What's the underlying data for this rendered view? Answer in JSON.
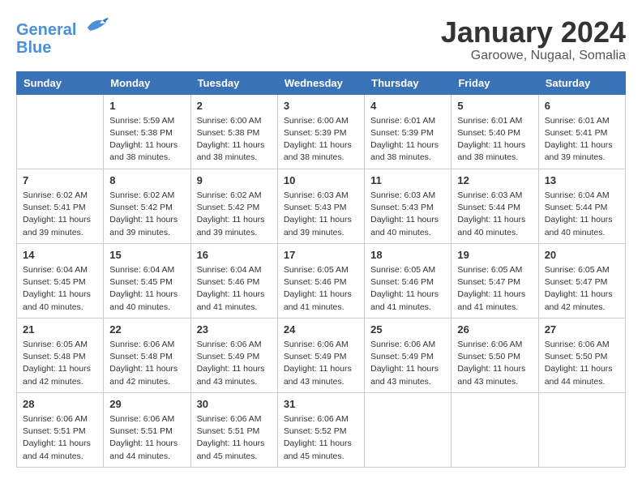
{
  "header": {
    "logo_line1": "General",
    "logo_line2": "Blue",
    "month_title": "January 2024",
    "subtitle": "Garoowe, Nugaal, Somalia"
  },
  "weekdays": [
    "Sunday",
    "Monday",
    "Tuesday",
    "Wednesday",
    "Thursday",
    "Friday",
    "Saturday"
  ],
  "weeks": [
    [
      {
        "day": "",
        "info": ""
      },
      {
        "day": "1",
        "info": "Sunrise: 5:59 AM\nSunset: 5:38 PM\nDaylight: 11 hours\nand 38 minutes."
      },
      {
        "day": "2",
        "info": "Sunrise: 6:00 AM\nSunset: 5:38 PM\nDaylight: 11 hours\nand 38 minutes."
      },
      {
        "day": "3",
        "info": "Sunrise: 6:00 AM\nSunset: 5:39 PM\nDaylight: 11 hours\nand 38 minutes."
      },
      {
        "day": "4",
        "info": "Sunrise: 6:01 AM\nSunset: 5:39 PM\nDaylight: 11 hours\nand 38 minutes."
      },
      {
        "day": "5",
        "info": "Sunrise: 6:01 AM\nSunset: 5:40 PM\nDaylight: 11 hours\nand 38 minutes."
      },
      {
        "day": "6",
        "info": "Sunrise: 6:01 AM\nSunset: 5:41 PM\nDaylight: 11 hours\nand 39 minutes."
      }
    ],
    [
      {
        "day": "7",
        "info": "Sunrise: 6:02 AM\nSunset: 5:41 PM\nDaylight: 11 hours\nand 39 minutes."
      },
      {
        "day": "8",
        "info": "Sunrise: 6:02 AM\nSunset: 5:42 PM\nDaylight: 11 hours\nand 39 minutes."
      },
      {
        "day": "9",
        "info": "Sunrise: 6:02 AM\nSunset: 5:42 PM\nDaylight: 11 hours\nand 39 minutes."
      },
      {
        "day": "10",
        "info": "Sunrise: 6:03 AM\nSunset: 5:43 PM\nDaylight: 11 hours\nand 39 minutes."
      },
      {
        "day": "11",
        "info": "Sunrise: 6:03 AM\nSunset: 5:43 PM\nDaylight: 11 hours\nand 40 minutes."
      },
      {
        "day": "12",
        "info": "Sunrise: 6:03 AM\nSunset: 5:44 PM\nDaylight: 11 hours\nand 40 minutes."
      },
      {
        "day": "13",
        "info": "Sunrise: 6:04 AM\nSunset: 5:44 PM\nDaylight: 11 hours\nand 40 minutes."
      }
    ],
    [
      {
        "day": "14",
        "info": "Sunrise: 6:04 AM\nSunset: 5:45 PM\nDaylight: 11 hours\nand 40 minutes."
      },
      {
        "day": "15",
        "info": "Sunrise: 6:04 AM\nSunset: 5:45 PM\nDaylight: 11 hours\nand 40 minutes."
      },
      {
        "day": "16",
        "info": "Sunrise: 6:04 AM\nSunset: 5:46 PM\nDaylight: 11 hours\nand 41 minutes."
      },
      {
        "day": "17",
        "info": "Sunrise: 6:05 AM\nSunset: 5:46 PM\nDaylight: 11 hours\nand 41 minutes."
      },
      {
        "day": "18",
        "info": "Sunrise: 6:05 AM\nSunset: 5:46 PM\nDaylight: 11 hours\nand 41 minutes."
      },
      {
        "day": "19",
        "info": "Sunrise: 6:05 AM\nSunset: 5:47 PM\nDaylight: 11 hours\nand 41 minutes."
      },
      {
        "day": "20",
        "info": "Sunrise: 6:05 AM\nSunset: 5:47 PM\nDaylight: 11 hours\nand 42 minutes."
      }
    ],
    [
      {
        "day": "21",
        "info": "Sunrise: 6:05 AM\nSunset: 5:48 PM\nDaylight: 11 hours\nand 42 minutes."
      },
      {
        "day": "22",
        "info": "Sunrise: 6:06 AM\nSunset: 5:48 PM\nDaylight: 11 hours\nand 42 minutes."
      },
      {
        "day": "23",
        "info": "Sunrise: 6:06 AM\nSunset: 5:49 PM\nDaylight: 11 hours\nand 43 minutes."
      },
      {
        "day": "24",
        "info": "Sunrise: 6:06 AM\nSunset: 5:49 PM\nDaylight: 11 hours\nand 43 minutes."
      },
      {
        "day": "25",
        "info": "Sunrise: 6:06 AM\nSunset: 5:49 PM\nDaylight: 11 hours\nand 43 minutes."
      },
      {
        "day": "26",
        "info": "Sunrise: 6:06 AM\nSunset: 5:50 PM\nDaylight: 11 hours\nand 43 minutes."
      },
      {
        "day": "27",
        "info": "Sunrise: 6:06 AM\nSunset: 5:50 PM\nDaylight: 11 hours\nand 44 minutes."
      }
    ],
    [
      {
        "day": "28",
        "info": "Sunrise: 6:06 AM\nSunset: 5:51 PM\nDaylight: 11 hours\nand 44 minutes."
      },
      {
        "day": "29",
        "info": "Sunrise: 6:06 AM\nSunset: 5:51 PM\nDaylight: 11 hours\nand 44 minutes."
      },
      {
        "day": "30",
        "info": "Sunrise: 6:06 AM\nSunset: 5:51 PM\nDaylight: 11 hours\nand 45 minutes."
      },
      {
        "day": "31",
        "info": "Sunrise: 6:06 AM\nSunset: 5:52 PM\nDaylight: 11 hours\nand 45 minutes."
      },
      {
        "day": "",
        "info": ""
      },
      {
        "day": "",
        "info": ""
      },
      {
        "day": "",
        "info": ""
      }
    ]
  ]
}
